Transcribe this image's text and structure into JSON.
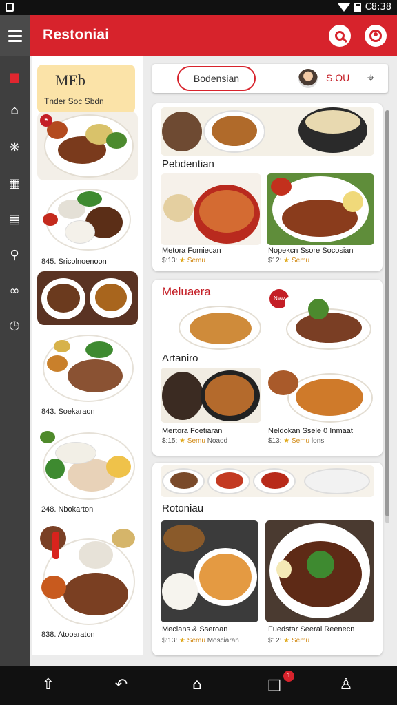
{
  "status_bar": {
    "time": "C8:38"
  },
  "app_bar": {
    "title": "Restoniai"
  },
  "rail": {
    "icons": [
      "store-icon",
      "home-icon",
      "tag-icon",
      "calendar-icon",
      "list-icon",
      "location-icon",
      "link-icon",
      "clock-icon"
    ]
  },
  "list_panel": {
    "featured": {
      "title": "MEb",
      "subtitle": "Tnder Soc Sbdn"
    },
    "items": [
      {
        "caption": ""
      },
      {
        "caption": "845. Sricolnoenoon"
      },
      {
        "caption": ""
      },
      {
        "caption": "843. Soekaraon"
      },
      {
        "caption": "248. Nbokarton"
      },
      {
        "caption": "838. Atooaraton"
      }
    ]
  },
  "filter_bar": {
    "active_tab": "Bodensian",
    "price": "S.OU"
  },
  "cards": [
    {
      "heading": "Pebdentian",
      "dishes": [
        {
          "name": "Metora Fomiecan",
          "price": "$:13:",
          "rating_label": "Semu",
          "extra": ""
        },
        {
          "name": "Nopekcn Ssore Socosian",
          "price": "$12:",
          "rating_label": "Semu",
          "extra": ""
        }
      ]
    },
    {
      "heading": "Meluaera",
      "badge": "New",
      "subheading": "Artaniro",
      "dishes": [
        {
          "name": "Mertora Foetiaran",
          "price": "$:15:",
          "rating_label": "Semu",
          "extra": "Noaod"
        },
        {
          "name": "Neldokan Ssele 0 Inmaat",
          "price": "$13:",
          "rating_label": "Semu",
          "extra": "lons"
        }
      ]
    },
    {
      "heading": "Rotoniau",
      "dishes": [
        {
          "name": "Mecians & Sseroan",
          "price": "$:13:",
          "rating_label": "Semu",
          "extra": "Mosciaran"
        },
        {
          "name": "Fuedstar Seeral Reenecn",
          "price": "$12:",
          "rating_label": "Semu",
          "extra": ""
        }
      ]
    }
  ],
  "bottom_nav": {
    "badge_count": "1"
  },
  "colors": {
    "brand_red": "#d7232c",
    "rail_gray": "#3f3f3f",
    "accent_gold": "#e0a81a"
  }
}
